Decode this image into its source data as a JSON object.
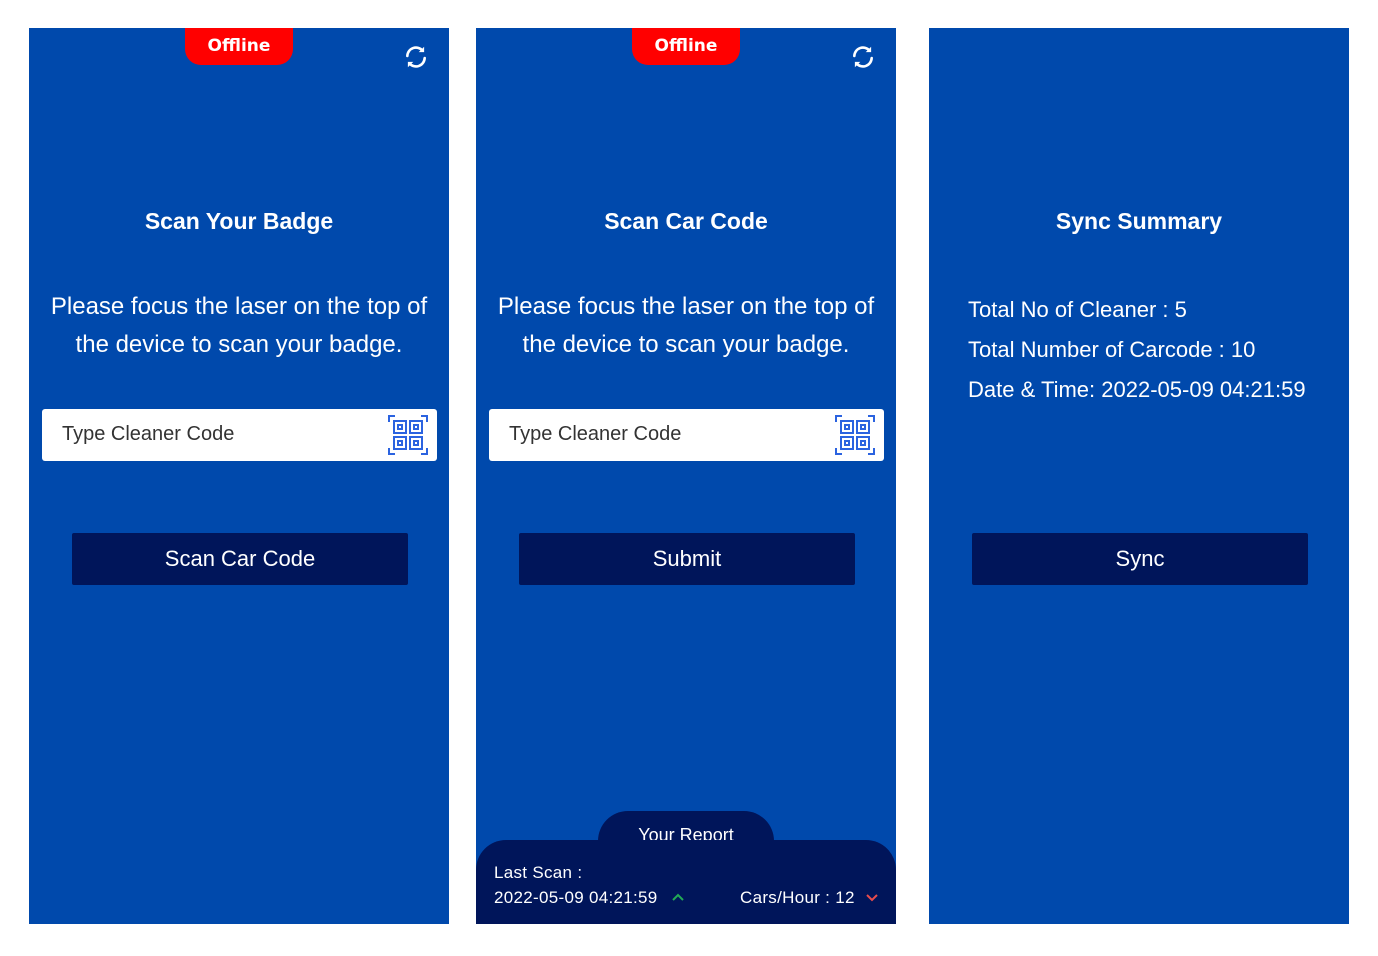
{
  "status_badge": "Offline",
  "colors": {
    "background": "#0049AC",
    "button": "#00155A",
    "offline": "#FF0000",
    "trend_up": "#22AA55",
    "trend_down": "#E84C4C"
  },
  "screen1": {
    "title": "Scan Your Badge",
    "description": "Please focus the laser on the top of the device to scan your badge.",
    "input_placeholder": "Type Cleaner Code",
    "button": "Scan Car Code"
  },
  "screen2": {
    "title": "Scan Car Code",
    "description": "Please focus the laser on the top of the device to scan your badge.",
    "input_placeholder": "Type Cleaner Code",
    "button": "Submit",
    "report": {
      "tab": "Your Report",
      "last_scan_label": "Last Scan :",
      "last_scan_value": "2022-05-09 04:21:59",
      "cars_per_hour": "Cars/Hour : 12"
    }
  },
  "screen3": {
    "title": "Sync Summary",
    "total_cleaners": "Total No of Cleaner : 5",
    "total_carcode": "Total Number of Carcode : 10",
    "datetime": "Date & Time: 2022-05-09 04:21:59",
    "button": "Sync"
  }
}
